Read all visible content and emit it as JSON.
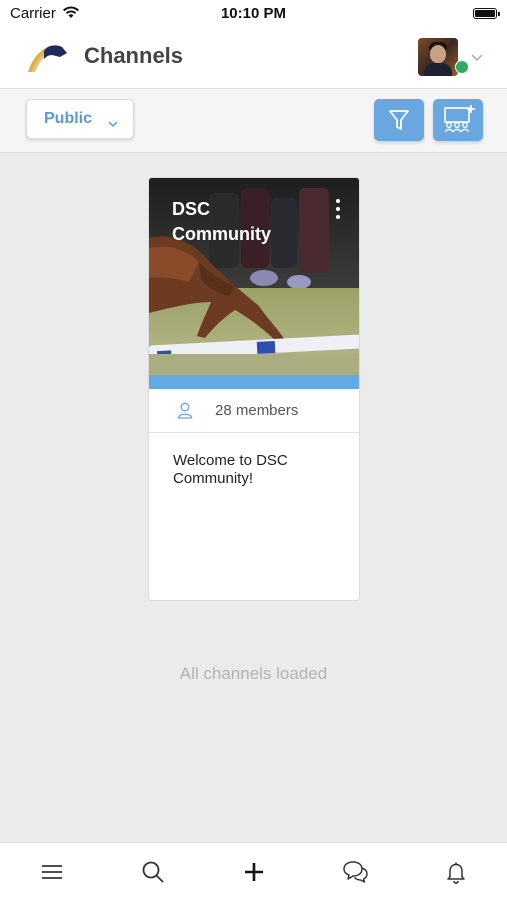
{
  "status_bar": {
    "carrier": "Carrier",
    "time": "10:10 PM"
  },
  "header": {
    "title": "Channels",
    "online_status_color": "#2eaa63"
  },
  "toolbar": {
    "visibility_filter": {
      "selected": "Public"
    },
    "accent_color": "#6aa6e0"
  },
  "channels": [
    {
      "name": "DSC Community",
      "members": "28 members",
      "description": "Welcome to DSC Community!"
    }
  ],
  "list_status": "All channels loaded",
  "bottom_nav": {
    "items": [
      "menu-icon",
      "search-icon",
      "plus-icon",
      "chat-icon",
      "bell-icon"
    ]
  }
}
